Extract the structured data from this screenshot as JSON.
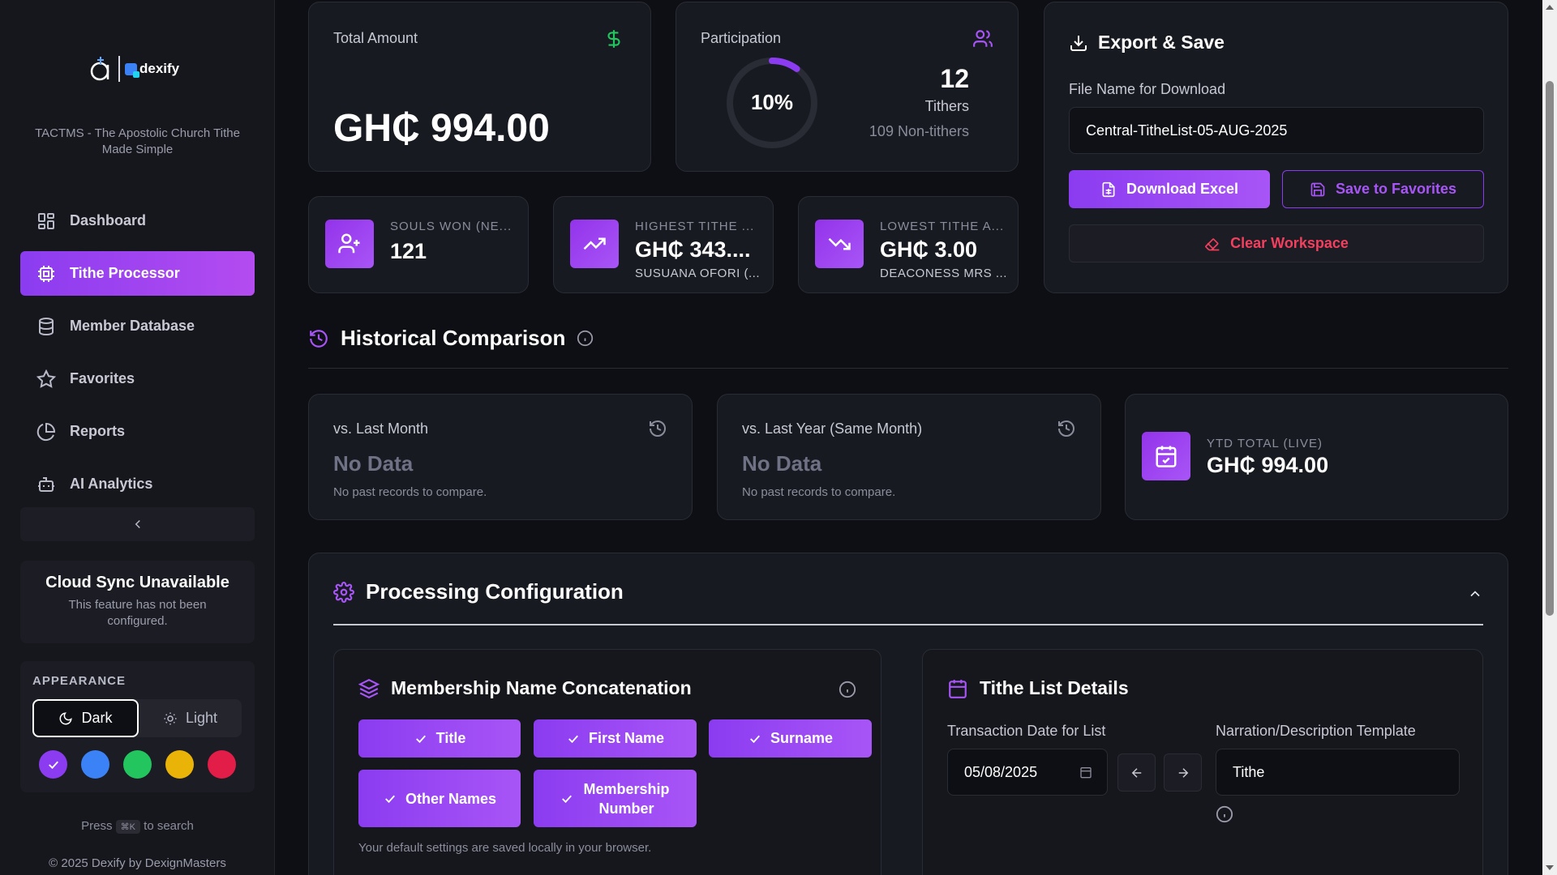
{
  "sidebar": {
    "tagline": "TACTMS - The Apostolic Church Tithe Made Simple",
    "logo_text": "dexify",
    "nav": [
      {
        "label": "Dashboard",
        "icon": "grid-icon",
        "active": false
      },
      {
        "label": "Tithe Processor",
        "icon": "cpu-icon",
        "active": true
      },
      {
        "label": "Member Database",
        "icon": "database-icon",
        "active": false
      },
      {
        "label": "Favorites",
        "icon": "star-icon",
        "active": false
      },
      {
        "label": "Reports",
        "icon": "pie-chart-icon",
        "active": false
      },
      {
        "label": "AI Analytics",
        "icon": "bot-icon",
        "active": false
      }
    ],
    "cloud": {
      "title": "Cloud Sync Unavailable",
      "subtitle": "This feature has not been configured."
    },
    "appearance": {
      "label": "APPEARANCE",
      "dark": "Dark",
      "light": "Light",
      "swatches": [
        "#8b3cf0",
        "#3b82f6",
        "#22c55e",
        "#eab308",
        "#e11d48"
      ]
    },
    "press_before": "Press",
    "press_key": "⌘K",
    "press_after": "to search",
    "copyright": "© 2025 Dexify by DexignMasters"
  },
  "total": {
    "label": "Total Amount",
    "value": "GH₵ 994.00"
  },
  "participation": {
    "label": "Participation",
    "percent": 10,
    "percent_text": "10%",
    "count": "12",
    "tithers": "Tithers",
    "non_tithers": "109 Non-tithers"
  },
  "export": {
    "title": "Export & Save",
    "file_label": "File Name for Download",
    "file_value": "Central-TitheList-05-AUG-2025",
    "download": "Download Excel",
    "save": "Save to Favorites",
    "clear": "Clear Workspace"
  },
  "stats": [
    {
      "caption": "SOULS WON (NE...",
      "value": "121",
      "sub": "",
      "icon": "user-plus-icon"
    },
    {
      "caption": "HIGHEST TITHE ...",
      "value": "GH₵ 343....",
      "sub": "SUSUANA OFORI (...",
      "icon": "trending-up-icon"
    },
    {
      "caption": "LOWEST TITHE A...",
      "value": "GH₵ 3.00",
      "sub": "DEACONESS MRS ...",
      "icon": "trending-down-icon"
    }
  ],
  "historical": {
    "title": "Historical Comparison",
    "last_month": {
      "title": "vs. Last Month",
      "value": "No Data",
      "note": "No past records to compare."
    },
    "last_year": {
      "title": "vs. Last Year (Same Month)",
      "value": "No Data",
      "note": "No past records to compare."
    },
    "ytd": {
      "caption": "YTD TOTAL (LIVE)",
      "value": "GH₵ 994.00"
    }
  },
  "config": {
    "title": "Processing Configuration",
    "membership": {
      "title": "Membership Name Concatenation",
      "chips": [
        "Title",
        "First Name",
        "Surname",
        "Other Names",
        "Membership Number"
      ],
      "note": "Your default settings are saved locally in your browser."
    },
    "tithe_list": {
      "title": "Tithe List Details",
      "date_label": "Transaction Date for List",
      "date_value": "05/08/2025",
      "narration_label": "Narration/Description Template",
      "narration_value": "Tithe"
    }
  }
}
